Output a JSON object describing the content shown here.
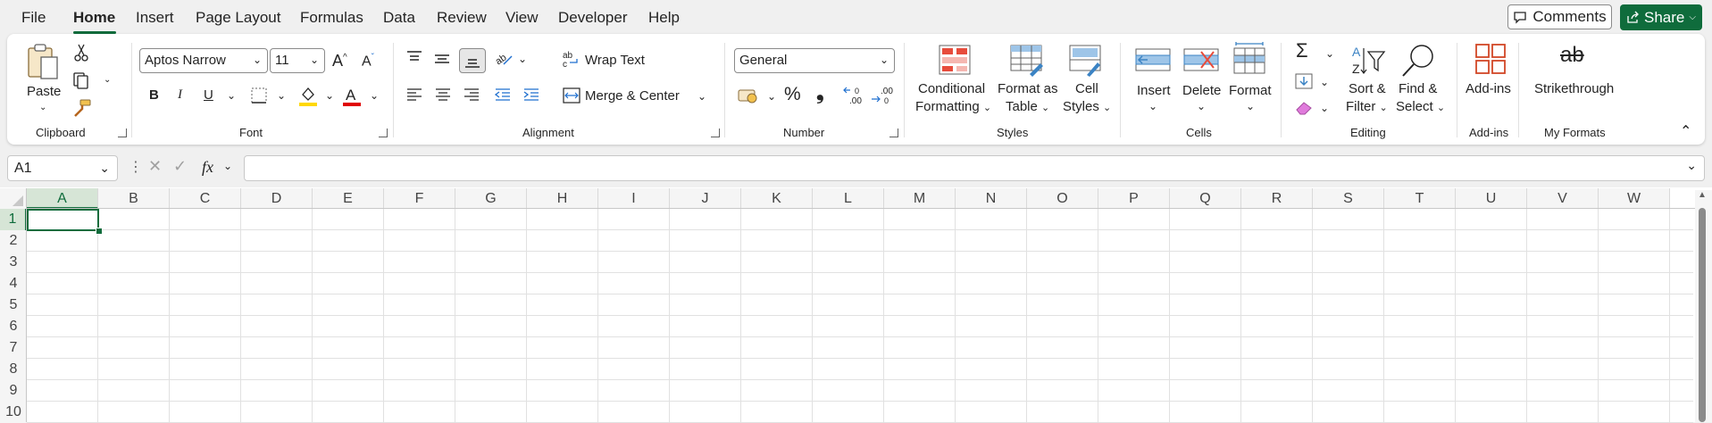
{
  "menu": {
    "tabs": [
      "File",
      "Home",
      "Insert",
      "Page Layout",
      "Formulas",
      "Data",
      "Review",
      "View",
      "Developer",
      "Help"
    ],
    "active_tab": "Home",
    "comments_label": "Comments",
    "share_label": "Share"
  },
  "clipboard": {
    "paste_label": "Paste",
    "group_label": "Clipboard"
  },
  "font": {
    "family": "Aptos Narrow",
    "size": "11",
    "group_label": "Font",
    "bold": "B",
    "italic": "I",
    "underline": "U",
    "fill_color": "#ffd800",
    "font_color": "#e00000"
  },
  "alignment": {
    "wrap_text": "Wrap Text",
    "merge_center": "Merge & Center",
    "group_label": "Alignment"
  },
  "number": {
    "format": "General",
    "group_label": "Number",
    "percent": "%",
    "comma": "❟"
  },
  "styles": {
    "conditional_1": "Conditional",
    "conditional_2": "Formatting",
    "format_table_1": "Format as",
    "format_table_2": "Table",
    "cell_styles_1": "Cell",
    "cell_styles_2": "Styles",
    "group_label": "Styles"
  },
  "cells": {
    "insert": "Insert",
    "delete": "Delete",
    "format": "Format",
    "group_label": "Cells"
  },
  "editing": {
    "sort_1": "Sort &",
    "sort_2": "Filter",
    "find_1": "Find &",
    "find_2": "Select",
    "group_label": "Editing"
  },
  "addins": {
    "label": "Add-ins",
    "group_label": "Add-ins"
  },
  "my_formats": {
    "strikethrough": "Strikethrough",
    "icon_text": "ab",
    "group_label": "My Formats"
  },
  "formula_bar": {
    "name_box": "A1",
    "formula": ""
  },
  "sheet": {
    "columns": [
      "A",
      "B",
      "C",
      "D",
      "E",
      "F",
      "G",
      "H",
      "I",
      "J",
      "K",
      "L",
      "M",
      "N",
      "O",
      "P",
      "Q",
      "R",
      "S",
      "T",
      "U",
      "V",
      "W"
    ],
    "rows": [
      "1",
      "2",
      "3",
      "4",
      "5",
      "6",
      "7",
      "8",
      "9",
      "10"
    ],
    "selected_cell": "A1"
  },
  "colors": {
    "accent": "#0f6c3c"
  }
}
